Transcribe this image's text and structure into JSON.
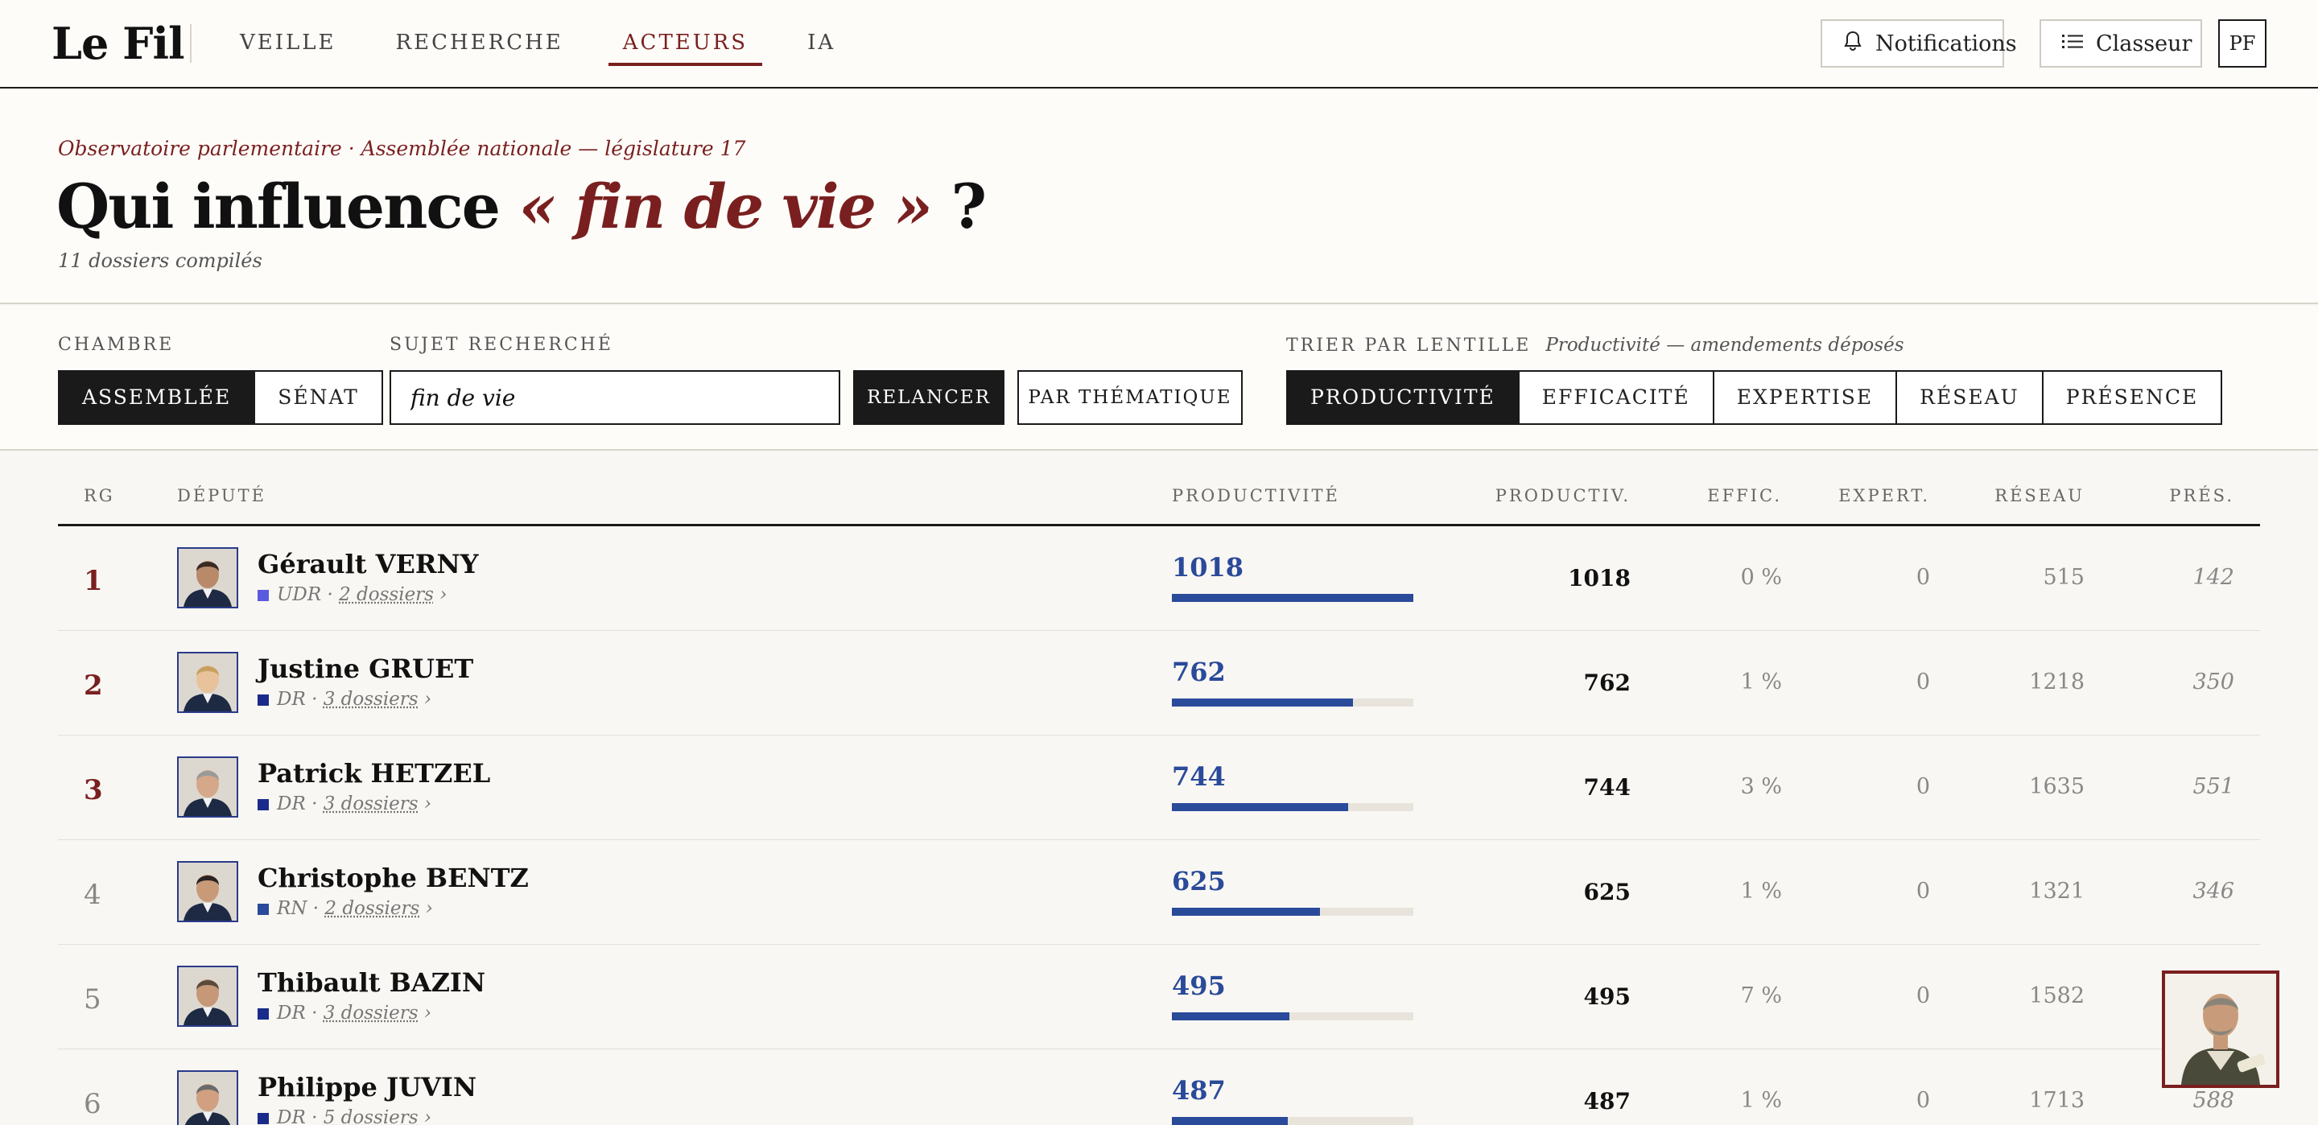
{
  "header": {
    "logo": "Le Fil",
    "nav": [
      "VEILLE",
      "RECHERCHE",
      "ACTEURS",
      "IA"
    ],
    "active_nav": "ACTEURS",
    "notifications_label": "Notifications",
    "classeur_label": "Classeur",
    "user_initials": "PF"
  },
  "hero": {
    "eyebrow": "Observatoire parlementaire · Assemblée nationale — législature 17",
    "title_prefix": "Qui influence ",
    "title_subject": "« fin de vie »",
    "title_suffix": " ?",
    "subtitle": "11 dossiers compilés"
  },
  "controls": {
    "chambre_label": "CHAMBRE",
    "chambre_options": [
      "ASSEMBLÉE",
      "SÉNAT"
    ],
    "chambre_selected": "ASSEMBLÉE",
    "sujet_label": "SUJET RECHERCHÉ",
    "sujet_value": "fin de vie",
    "relancer_label": "RELANCER",
    "thematique_label": "PAR THÉMATIQUE",
    "tri_label": "TRIER PAR LENTILLE",
    "tri_hint": "Productivité — amendements déposés",
    "lentilles": [
      "PRODUCTIVITÉ",
      "EFFICACITÉ",
      "EXPERTISE",
      "RÉSEAU",
      "PRÉSENCE"
    ],
    "lentille_selected": "PRODUCTIVITÉ"
  },
  "table": {
    "headers": {
      "rank": "RG",
      "depute": "DÉPUTÉ",
      "lens": "PRODUCTIVITÉ",
      "productiv": "PRODUCTIV.",
      "effic": "EFFIC.",
      "expert": "EXPERT.",
      "reseau": "RÉSEAU",
      "pres": "PRÉS."
    },
    "lens_max": 1018,
    "rows": [
      {
        "rank": "1",
        "name": "Gérault VERNY",
        "party": "UDR",
        "party_color": "#5a5adf",
        "dossiers": "2 dossiers",
        "lens_value": 1018,
        "productiv": "1018",
        "effic": "0 %",
        "expert": "0",
        "reseau": "515",
        "pres": "142"
      },
      {
        "rank": "2",
        "name": "Justine GRUET",
        "party": "DR",
        "party_color": "#1a2a8a",
        "dossiers": "3 dossiers",
        "lens_value": 762,
        "productiv": "762",
        "effic": "1 %",
        "expert": "0",
        "reseau": "1218",
        "pres": "350"
      },
      {
        "rank": "3",
        "name": "Patrick HETZEL",
        "party": "DR",
        "party_color": "#1a2a8a",
        "dossiers": "3 dossiers",
        "lens_value": 744,
        "productiv": "744",
        "effic": "3 %",
        "expert": "0",
        "reseau": "1635",
        "pres": "551"
      },
      {
        "rank": "4",
        "name": "Christophe BENTZ",
        "party": "RN",
        "party_color": "#2a4a9a",
        "dossiers": "2 dossiers",
        "lens_value": 625,
        "productiv": "625",
        "effic": "1 %",
        "expert": "0",
        "reseau": "1321",
        "pres": "346"
      },
      {
        "rank": "5",
        "name": "Thibault BAZIN",
        "party": "DR",
        "party_color": "#1a2a8a",
        "dossiers": "3 dossiers",
        "lens_value": 495,
        "productiv": "495",
        "effic": "7 %",
        "expert": "0",
        "reseau": "1582",
        "pres": ""
      },
      {
        "rank": "6",
        "name": "Philippe JUVIN",
        "party": "DR",
        "party_color": "#1a2a8a",
        "dossiers": "5 dossiers",
        "lens_value": 487,
        "productiv": "487",
        "effic": "1 %",
        "expert": "0",
        "reseau": "1713",
        "pres": "588"
      }
    ]
  },
  "colors": {
    "accent": "#7a1f1f",
    "bar": "#2a4a9a",
    "ink": "#1a1a1a"
  }
}
